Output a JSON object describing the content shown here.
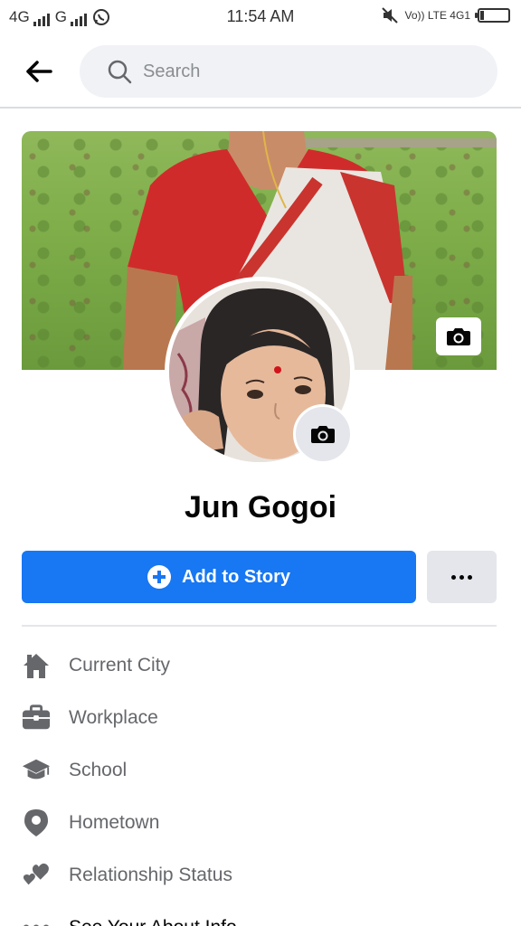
{
  "status_bar": {
    "network1": "4G",
    "network2": "G",
    "time": "11:54 AM",
    "right_text": "Vo)) LTE 4G1"
  },
  "header": {
    "back_icon": "arrow-left-icon",
    "search": {
      "placeholder": "Search",
      "icon": "search-icon"
    }
  },
  "profile": {
    "name": "Jun Gogoi",
    "cover_camera_icon": "camera-icon",
    "profile_camera_icon": "camera-icon"
  },
  "actions": {
    "add_story_label": "Add to Story",
    "more_label": "..."
  },
  "info_items": [
    {
      "icon": "home-icon",
      "label": "Current City"
    },
    {
      "icon": "briefcase-icon",
      "label": "Workplace"
    },
    {
      "icon": "graduation-cap-icon",
      "label": "School"
    },
    {
      "icon": "location-pin-icon",
      "label": "Hometown"
    },
    {
      "icon": "heart-icon",
      "label": "Relationship Status"
    },
    {
      "icon": "more-dots-icon",
      "label": "See Your About Info"
    }
  ],
  "colors": {
    "primary": "#1877f2",
    "secondary_bg": "#e4e6eb",
    "text_secondary": "#65676b"
  }
}
